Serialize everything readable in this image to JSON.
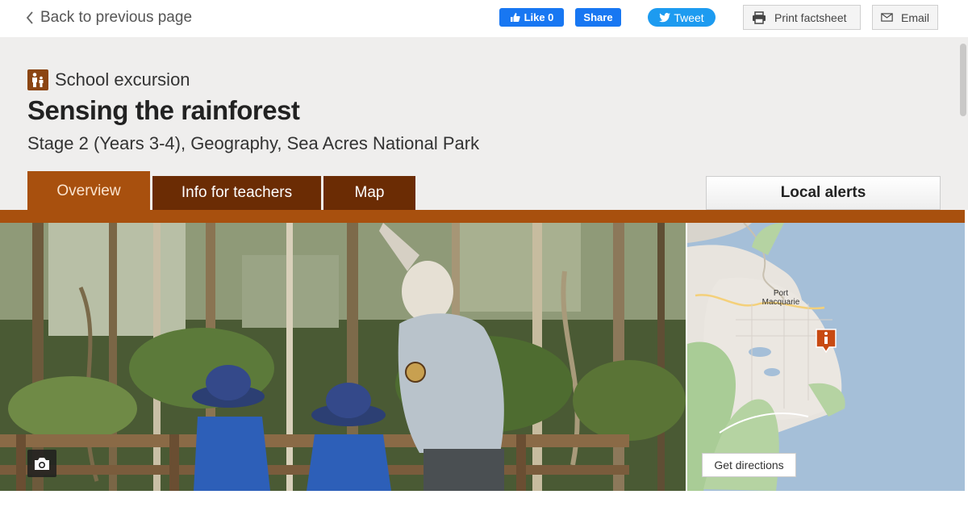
{
  "nav": {
    "back_label": "Back to previous page"
  },
  "social": {
    "like_label": "Like 0",
    "share_label": "Share",
    "tweet_label": "Tweet",
    "print_label": "Print factsheet",
    "email_label": "Email"
  },
  "header": {
    "category": "School excursion",
    "title": "Sensing the rainforest",
    "subtitle": "Stage 2 (Years 3-4), Geography, Sea Acres National Park"
  },
  "tabs": [
    {
      "label": "Overview",
      "active": true
    },
    {
      "label": "Info for teachers",
      "active": false
    },
    {
      "label": "Map",
      "active": false
    }
  ],
  "alerts": {
    "label": "Local alerts"
  },
  "map": {
    "place_label": "Port Macquarie",
    "directions_label": "Get directions"
  },
  "icons": {
    "category": "family-icon",
    "camera": "camera-icon",
    "marker": "info-marker-icon"
  },
  "colors": {
    "brand_brown": "#a8500e",
    "tab_dark": "#6b2c04",
    "facebook": "#1877f2",
    "twitter": "#1d9bf0"
  }
}
